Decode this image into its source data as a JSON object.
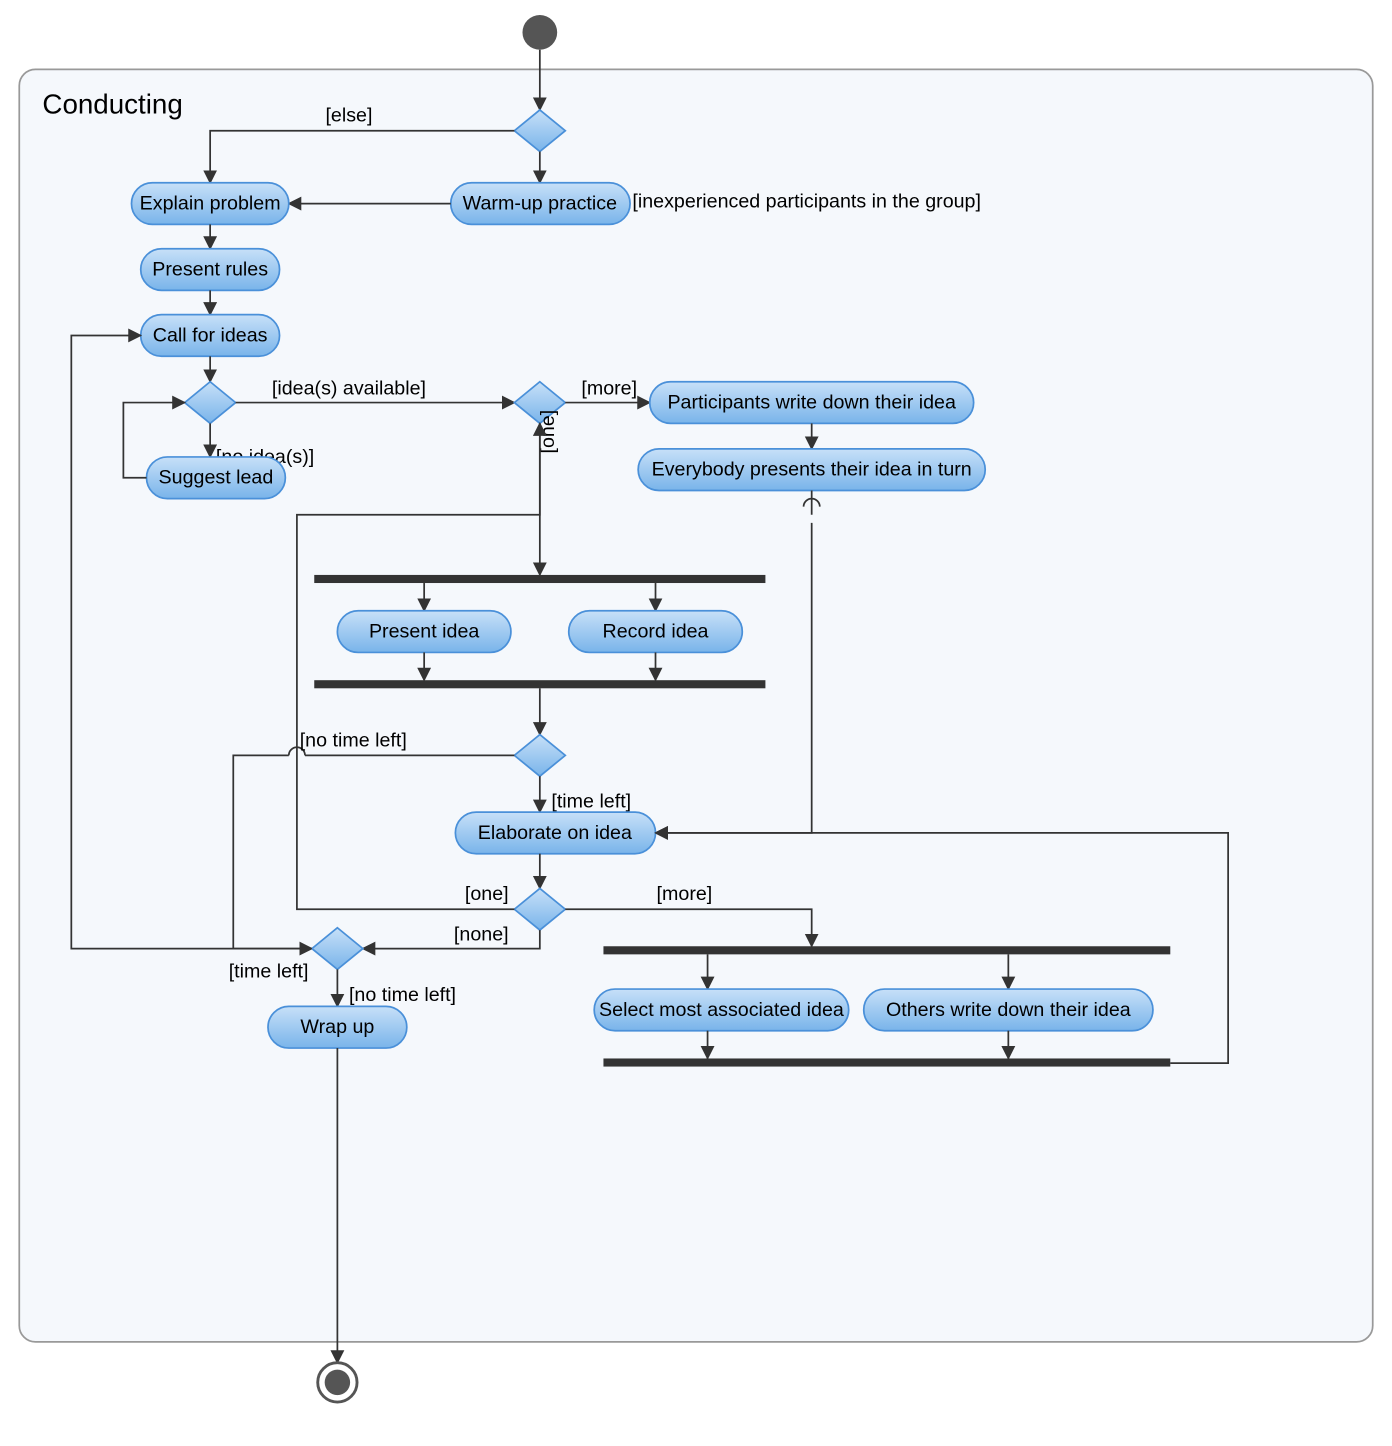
{
  "chart_data": {
    "type": "uml-activity-diagram",
    "title": "Conducting",
    "initial_node": "start",
    "final_node": "end",
    "nodes": [
      {
        "id": "start",
        "kind": "initial"
      },
      {
        "id": "d_exp",
        "kind": "decision"
      },
      {
        "id": "warmup",
        "kind": "activity",
        "label": "Warm-up practice"
      },
      {
        "id": "explain",
        "kind": "activity",
        "label": "Explain problem"
      },
      {
        "id": "rules",
        "kind": "activity",
        "label": "Present rules"
      },
      {
        "id": "call",
        "kind": "activity",
        "label": "Call for ideas"
      },
      {
        "id": "d_ideas",
        "kind": "decision"
      },
      {
        "id": "suggest",
        "kind": "activity",
        "label": "Suggest lead"
      },
      {
        "id": "d_count",
        "kind": "decision"
      },
      {
        "id": "write",
        "kind": "activity",
        "label": "Participants write down their idea"
      },
      {
        "id": "present_each",
        "kind": "activity",
        "label": "Everybody presents their idea in turn"
      },
      {
        "id": "fork1",
        "kind": "fork"
      },
      {
        "id": "present",
        "kind": "activity",
        "label": "Present idea"
      },
      {
        "id": "record",
        "kind": "activity",
        "label": "Record idea"
      },
      {
        "id": "join1",
        "kind": "join"
      },
      {
        "id": "d_time",
        "kind": "decision"
      },
      {
        "id": "elab",
        "kind": "activity",
        "label": "Elaborate on idea"
      },
      {
        "id": "d_more",
        "kind": "decision"
      },
      {
        "id": "fork2",
        "kind": "fork"
      },
      {
        "id": "select",
        "kind": "activity",
        "label": "Select most associated idea"
      },
      {
        "id": "others",
        "kind": "activity",
        "label": "Others write down their idea"
      },
      {
        "id": "join2",
        "kind": "join"
      },
      {
        "id": "d_wrap",
        "kind": "decision"
      },
      {
        "id": "wrap",
        "kind": "activity",
        "label": "Wrap up"
      },
      {
        "id": "end",
        "kind": "final"
      }
    ],
    "edges": [
      {
        "from": "start",
        "to": "d_exp"
      },
      {
        "from": "d_exp",
        "to": "explain",
        "guard": "[else]"
      },
      {
        "from": "d_exp",
        "to": "warmup",
        "guard": "[inexperienced participants in the group]"
      },
      {
        "from": "warmup",
        "to": "explain"
      },
      {
        "from": "explain",
        "to": "rules"
      },
      {
        "from": "rules",
        "to": "call"
      },
      {
        "from": "call",
        "to": "d_ideas"
      },
      {
        "from": "d_ideas",
        "to": "suggest",
        "guard": "[no idea(s)]"
      },
      {
        "from": "suggest",
        "to": "d_ideas"
      },
      {
        "from": "d_ideas",
        "to": "d_count",
        "guard": "[idea(s) available]"
      },
      {
        "from": "d_count",
        "to": "write",
        "guard": "[more]"
      },
      {
        "from": "write",
        "to": "present_each"
      },
      {
        "from": "present_each",
        "to": "elab"
      },
      {
        "from": "d_count",
        "to": "fork1",
        "guard": "[one]"
      },
      {
        "from": "fork1",
        "to": "present"
      },
      {
        "from": "fork1",
        "to": "record"
      },
      {
        "from": "present",
        "to": "join1"
      },
      {
        "from": "record",
        "to": "join1"
      },
      {
        "from": "join1",
        "to": "d_time"
      },
      {
        "from": "d_time",
        "to": "elab",
        "guard": "[time left]"
      },
      {
        "from": "d_time",
        "to": "d_wrap",
        "guard": "[no time left]"
      },
      {
        "from": "elab",
        "to": "d_more"
      },
      {
        "from": "d_more",
        "to": "d_count",
        "guard": "[one]"
      },
      {
        "from": "d_more",
        "to": "d_wrap",
        "guard": "[none]"
      },
      {
        "from": "d_more",
        "to": "fork2",
        "guard": "[more]"
      },
      {
        "from": "fork2",
        "to": "select"
      },
      {
        "from": "fork2",
        "to": "others"
      },
      {
        "from": "select",
        "to": "join2"
      },
      {
        "from": "others",
        "to": "join2"
      },
      {
        "from": "join2",
        "to": "elab"
      },
      {
        "from": "d_wrap",
        "to": "call",
        "guard": "[time left]"
      },
      {
        "from": "d_wrap",
        "to": "wrap",
        "guard": "[no time left]"
      },
      {
        "from": "wrap",
        "to": "end"
      }
    ]
  },
  "frame_title": "Conducting",
  "activities": {
    "warmup": "Warm-up practice",
    "explain": "Explain problem",
    "rules": "Present rules",
    "call": "Call for ideas",
    "suggest": "Suggest lead",
    "write": "Participants write down their idea",
    "present_each": "Everybody presents their idea in turn",
    "present": "Present idea",
    "record": "Record idea",
    "elab": "Elaborate on idea",
    "select": "Select most associated idea",
    "others": "Others write down their idea",
    "wrap": "Wrap up"
  },
  "guards": {
    "else": "[else]",
    "inexp": "[inexperienced participants in the group]",
    "avail": "[idea(s) available]",
    "noidea": "[no idea(s)]",
    "more": "[more]",
    "one": "[one]",
    "none": "[none]",
    "timel": "[time left]",
    "notime": "[no time left]",
    "notime2": "[no time left]",
    "more2": "[more]",
    "one2": "[one]",
    "timel2": "[time left]"
  }
}
